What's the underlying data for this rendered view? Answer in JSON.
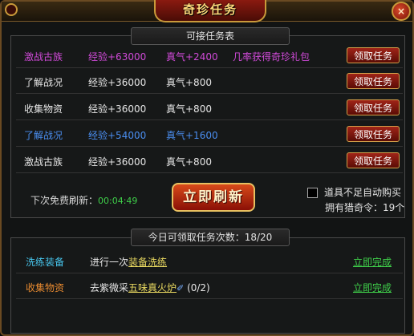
{
  "window": {
    "title": "奇珍任务",
    "close_label": "×"
  },
  "task_table": {
    "header": "可接任务表",
    "rows": [
      {
        "name": "激战古族",
        "exp": "经验+63000",
        "qi": "真气+2400",
        "extra": "几率获得奇珍礼包",
        "button": "领取任务",
        "color": "#d04ad8"
      },
      {
        "name": "了解战况",
        "exp": "经验+36000",
        "qi": "真气+800",
        "extra": "",
        "button": "领取任务",
        "color": "#e6e6e6"
      },
      {
        "name": "收集物资",
        "exp": "经验+36000",
        "qi": "真气+800",
        "extra": "",
        "button": "领取任务",
        "color": "#e6e6e6"
      },
      {
        "name": "了解战况",
        "exp": "经验+54000",
        "qi": "真气+1600",
        "extra": "",
        "button": "领取任务",
        "color": "#4a8ef0"
      },
      {
        "name": "激战古族",
        "exp": "经验+36000",
        "qi": "真气+800",
        "extra": "",
        "button": "领取任务",
        "color": "#e6e6e6"
      }
    ]
  },
  "refresh": {
    "timer_label": "下次免费刷新：",
    "timer_value": "00:04:49",
    "button_label": "立即刷新",
    "autobuy_label": "道具不足自动购买",
    "autobuy_checked": false,
    "owned_text": "拥有猎奇令：19个"
  },
  "daily": {
    "header": "今日可领取任务次数：18/20",
    "rows": [
      {
        "name": "洗练装备",
        "desc_prefix": "进行一次",
        "desc_link": "装备洗练",
        "desc_suffix": "",
        "action": "立即完成",
        "color": "#48c8f0"
      },
      {
        "name": "收集物资",
        "desc_prefix": "去紫微采",
        "desc_link": "五味真火炉",
        "desc_suffix": " (0/2)",
        "action": "立即完成",
        "color": "#e88a30",
        "icon": "scroll-icon"
      }
    ]
  },
  "colors": {
    "accent_red": "#a02418",
    "gold": "#d2a14a",
    "green": "#3fd04a",
    "purple": "#d04ad8",
    "blue": "#4a8ef0"
  }
}
